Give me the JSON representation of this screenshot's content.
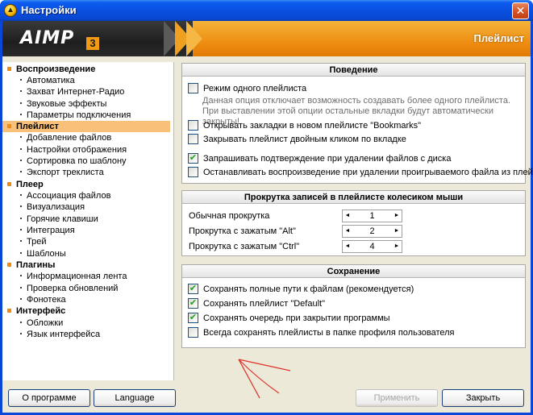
{
  "window": {
    "title": "Настройки",
    "close_glyph": "✕",
    "icon": "aimp-icon"
  },
  "header": {
    "logo": "AIMP",
    "logo_superscript": "3",
    "section_title": "Плейлист"
  },
  "sidebar": {
    "groups": [
      {
        "label": "Воспроизведение",
        "items": [
          "Автоматика",
          "Захват Интернет-Радио",
          "Звуковые эффекты",
          "Параметры подключения"
        ]
      },
      {
        "label": "Плейлист",
        "selected": true,
        "items": [
          "Добавление файлов",
          "Настройки отображения",
          "Сортировка по шаблону",
          "Экспорт треклиста"
        ]
      },
      {
        "label": "Плеер",
        "items": [
          "Ассоциация файлов",
          "Визуализация",
          "Горячие клавиши",
          "Интеграция",
          "Трей",
          "Шаблоны"
        ]
      },
      {
        "label": "Плагины",
        "items": [
          "Информационная лента",
          "Проверка обновлений",
          "Фонотека"
        ]
      },
      {
        "label": "Интерфейс",
        "items": [
          "Обложки",
          "Язык интерфейса"
        ]
      }
    ]
  },
  "behavior": {
    "title": "Поведение",
    "single_playlist": {
      "label": "Режим одного плейлиста",
      "checked": false
    },
    "single_playlist_hint_1": "Данная опция отключает возможность создавать более одного плейлиста.",
    "single_playlist_hint_2": "При выставлении этой опции остальные вкладки будут автоматически закрыты!",
    "open_bookmarks": {
      "label": "Открывать закладки в новом плейлисте \"Bookmarks\"",
      "checked": false
    },
    "close_dblclick": {
      "label": "Закрывать плейлист двойным кликом по вкладке",
      "checked": false
    },
    "confirm_delete": {
      "label": "Запрашивать подтверждение при удалении файлов с диска",
      "checked": true
    },
    "stop_on_delete": {
      "label": "Останавливать воспроизведение при удалении проигрываемого файла из плейлиста",
      "checked": false
    }
  },
  "scroll": {
    "title": "Прокрутка записей в плейлисте колесиком мыши",
    "normal": {
      "label": "Обычная прокрутка",
      "value": "1"
    },
    "alt": {
      "label": "Прокрутка с зажатым \"Alt\"",
      "value": "2"
    },
    "ctrl": {
      "label": "Прокрутка с зажатым \"Ctrl\"",
      "value": "4"
    },
    "left_glyph": "◄",
    "right_glyph": "►"
  },
  "saving": {
    "title": "Сохранение",
    "full_paths": {
      "label": "Сохранять полные пути к файлам (рекомендуется)",
      "checked": true
    },
    "default_playlist": {
      "label": "Сохранять плейлист \"Default\"",
      "checked": true
    },
    "queue": {
      "label": "Сохранять очередь при закрытии программы",
      "checked": true
    },
    "profile_folder": {
      "label": "Всегда сохранять плейлисты в папке профиля пользователя",
      "checked": false
    }
  },
  "footer": {
    "about": "О программе",
    "language": "Language",
    "apply": "Применить",
    "close": "Закрыть"
  },
  "check_glyph": "✔",
  "colors": {
    "accent_orange": "#ee8e12",
    "selection": "#f9c07a",
    "titlebar_blue": "#0a50e0",
    "annotation_red": "#e0332a"
  }
}
